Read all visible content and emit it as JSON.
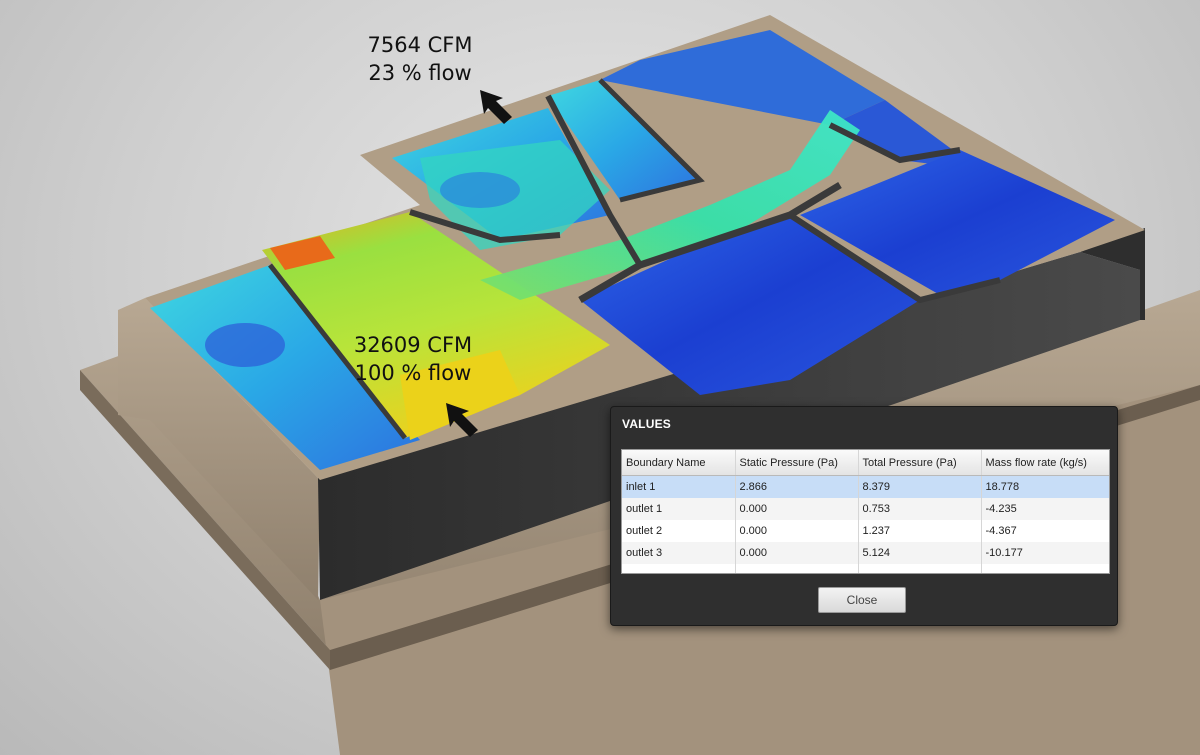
{
  "annotations": {
    "outlet": {
      "cfm": "7564 CFM",
      "flow": "23 % flow"
    },
    "inlet": {
      "cfm": "32609 CFM",
      "flow": "100 % flow"
    }
  },
  "dialog": {
    "title": "VALUES",
    "columns": [
      "Boundary Name",
      "Static Pressure (Pa)",
      "Total Pressure (Pa)",
      "Mass flow rate (kg/s)"
    ],
    "rows": [
      [
        "inlet 1",
        "2.866",
        "8.379",
        "18.778"
      ],
      [
        "outlet 1",
        "0.000",
        "0.753",
        "-4.235"
      ],
      [
        "outlet 2",
        "0.000",
        "1.237",
        "-4.367"
      ],
      [
        "outlet 3",
        "0.000",
        "5.124",
        "-10.177"
      ]
    ],
    "selected_row": 0,
    "close_label": "Close"
  },
  "colors": {
    "wall_dark": "#3a3a3a",
    "wall_tan": "#a69682",
    "flow_low": "#1a3fd0",
    "flow_mid": "#2fe0d0",
    "flow_high": "#f0d020",
    "selection": "#c7ddf7"
  },
  "icons": [
    "outlet-arrow-icon",
    "inlet-arrow-icon"
  ]
}
